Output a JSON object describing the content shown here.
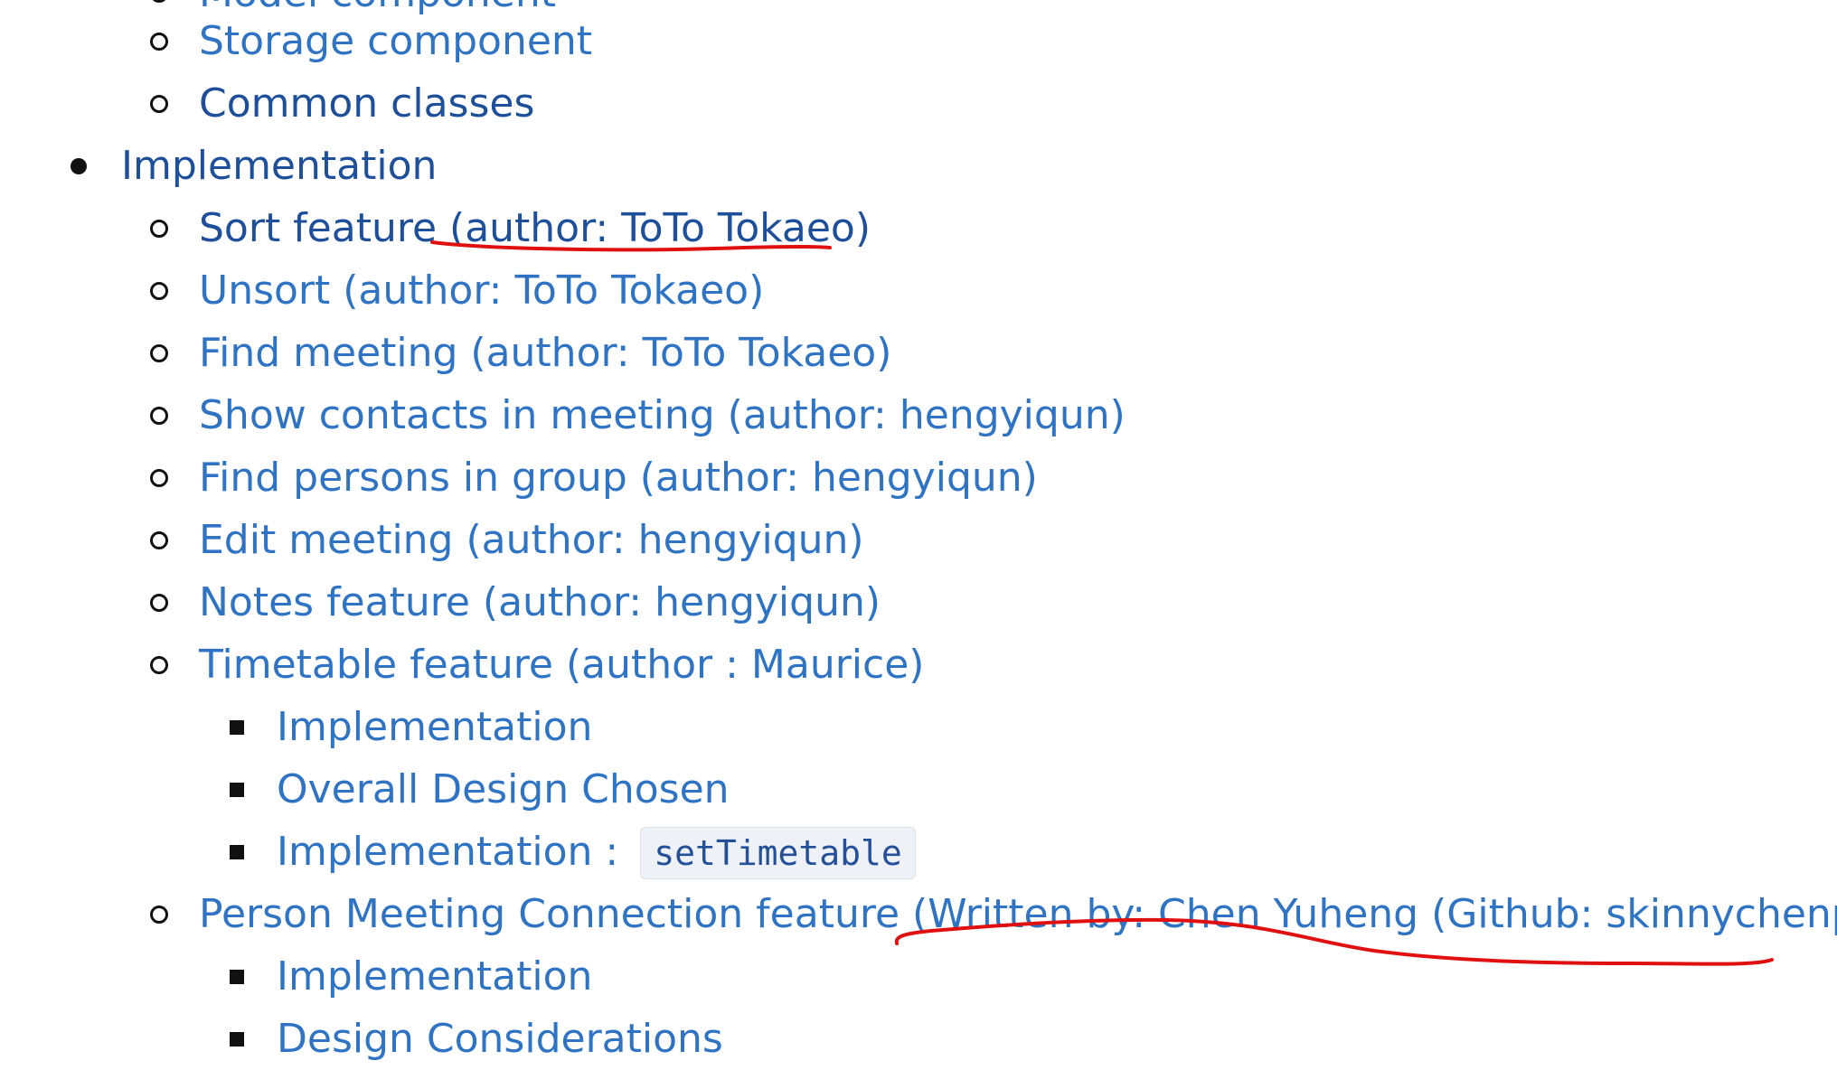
{
  "toc": {
    "partial_top_label": "Model component",
    "storage_component": "Storage component",
    "common_classes": "Common classes",
    "implementation": "Implementation",
    "items": [
      {
        "label": "Sort feature ",
        "author": "(author: ToTo Tokaeo)"
      },
      {
        "label": "Unsort (author: ToTo Tokaeo)"
      },
      {
        "label": "Find meeting (author: ToTo Tokaeo)"
      },
      {
        "label": "Show contacts in meeting (author: hengyiqun)"
      },
      {
        "label": "Find persons in group (author: hengyiqun)"
      },
      {
        "label": "Edit meeting (author: hengyiqun)"
      },
      {
        "label": "Notes feature (author: hengyiqun)"
      },
      {
        "label": "Timetable feature (author : Maurice)"
      }
    ],
    "timetable_sub": {
      "implementation": "Implementation",
      "overall_design": "Overall Design Chosen",
      "impl_prefix": "Implementation : ",
      "impl_code": "setTimetable"
    },
    "person_meeting": "Person Meeting Connection feature (Written by: Chen Yuheng (Github: skinnychenpi))",
    "person_meeting_sub": {
      "implementation": "Implementation",
      "design_considerations": "Design Considerations"
    }
  },
  "colors": {
    "link": "#2f73c4",
    "visited_link": "#1e4f9b",
    "annotation": "#e01010"
  }
}
